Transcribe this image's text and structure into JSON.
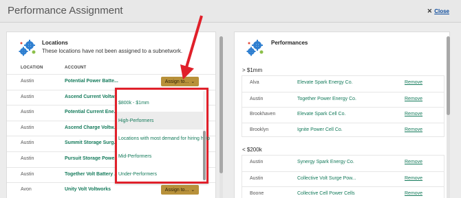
{
  "window": {
    "title": "Performance Assignment",
    "close_label": "Close"
  },
  "locations": {
    "title": "Locations",
    "subtitle": "These locations have not been assigned to a subnetwork.",
    "columns": [
      "LOCATION",
      "ACCOUNT"
    ],
    "rows": [
      {
        "location": "Austin",
        "account": "Potential Power Batte...",
        "has_button": true
      },
      {
        "location": "Austin",
        "account": "Ascend Current Voltw...",
        "has_button": false
      },
      {
        "location": "Austin",
        "account": "Potential Current Ene...",
        "has_button": false
      },
      {
        "location": "Austin",
        "account": "Ascend Charge Voltw...",
        "has_button": false
      },
      {
        "location": "Austin",
        "account": "Summit Storage Surg...",
        "has_button": false
      },
      {
        "location": "Austin",
        "account": "Pursuit Storage Powe...",
        "has_button": false
      },
      {
        "location": "Austin",
        "account": "Together Volt Battery ...",
        "has_button": false
      },
      {
        "location": "Avon",
        "account": "Unity Volt Voltworks",
        "has_button": true
      }
    ],
    "assign_label": "Assign to...",
    "dropdown_options": [
      "$800k - $1mm",
      "High-Performers",
      "Locations with most demand for hiring help",
      "Mid-Performers",
      "Under-Performers"
    ],
    "dropdown_highlighted_index": 1
  },
  "performances": {
    "title": "Performances",
    "remove_label": "Remove",
    "groups": [
      {
        "name": "> $1mm",
        "rows": [
          {
            "location": "Alva",
            "name": "Elevate Spark Energy Co."
          },
          {
            "location": "Austin",
            "name": "Together Power Energy Co."
          },
          {
            "location": "Brookhaven",
            "name": "Elevate Spark Cell Co."
          },
          {
            "location": "Brooklyn",
            "name": "Ignite Power Cell Co."
          }
        ]
      },
      {
        "name": "< $200k",
        "rows": [
          {
            "location": "Austin",
            "name": "Synergy Spark Energy Co."
          },
          {
            "location": "Austin",
            "name": "Collective Volt Surge Pow..."
          },
          {
            "location": "Boone",
            "name": "Collective Cell Power Cells"
          }
        ]
      }
    ]
  },
  "colors": {
    "accent_green": "#137a5a",
    "assign_button": "#b8913a",
    "annotation_red": "#e0202a",
    "gear_blue": "#2f7fd0"
  }
}
